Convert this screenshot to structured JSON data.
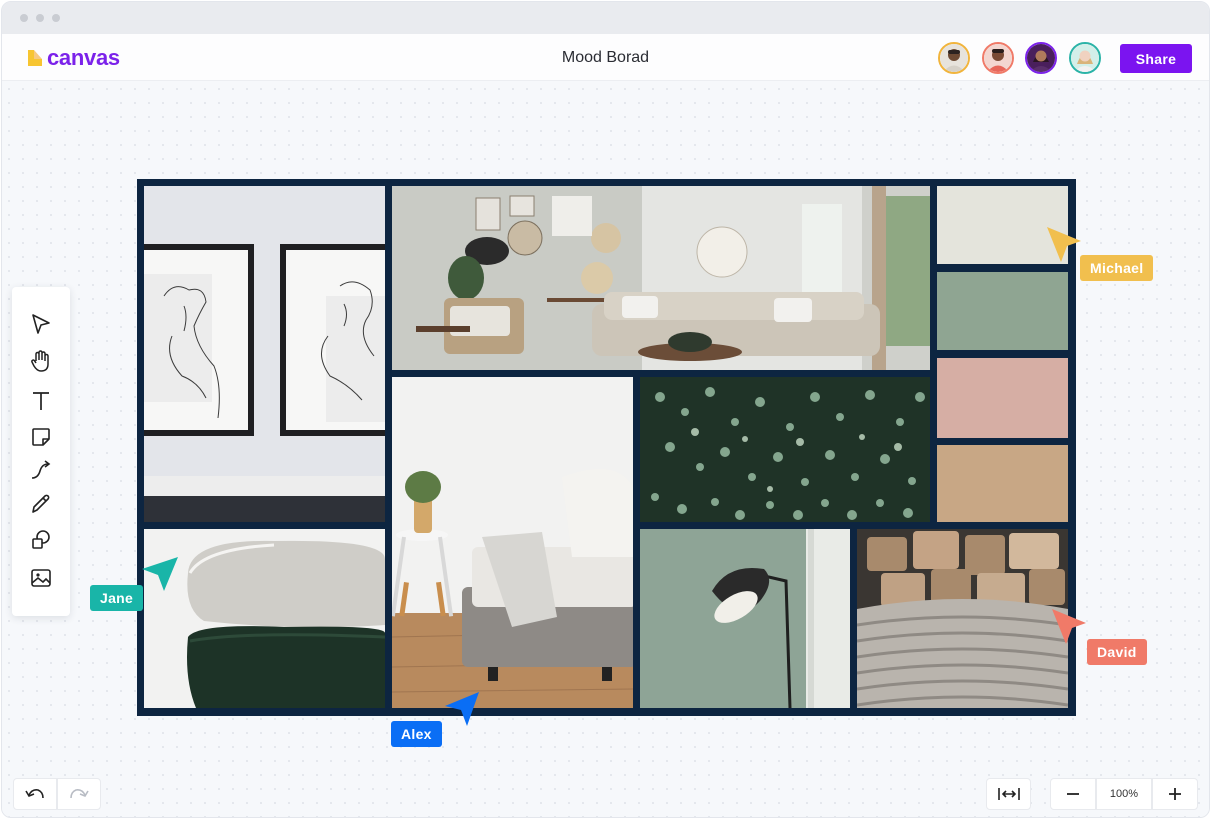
{
  "app": {
    "brand": "canvas",
    "title": "Mood Borad",
    "brand_color": "#7b22ea",
    "share_label": "Share"
  },
  "collaborators": [
    {
      "name": "avatar-1",
      "ring": "#f1b43c"
    },
    {
      "name": "avatar-2",
      "ring": "#f07a68"
    },
    {
      "name": "avatar-3",
      "ring": "#7b22ea"
    },
    {
      "name": "avatar-4",
      "ring": "#2bb3a7"
    }
  ],
  "tools": [
    {
      "name": "select-tool",
      "icon": "pointer-arrow-icon"
    },
    {
      "name": "hand-tool",
      "icon": "hand-icon"
    },
    {
      "name": "text-tool",
      "icon": "text-icon"
    },
    {
      "name": "sticky-note-tool",
      "icon": "sticky-note-icon"
    },
    {
      "name": "connector-tool",
      "icon": "connector-icon"
    },
    {
      "name": "pen-tool",
      "icon": "pencil-icon"
    },
    {
      "name": "shapes-tool",
      "icon": "shapes-icon"
    },
    {
      "name": "image-tool",
      "icon": "image-icon"
    }
  ],
  "palette": [
    "#e4e4dc",
    "#8fa592",
    "#d6aea4",
    "#c8a785"
  ],
  "cursors": {
    "michael": {
      "label": "Michael",
      "color": "#f1bf4e"
    },
    "jane": {
      "label": "Jane",
      "color": "#19b5a8"
    },
    "david": {
      "label": "David",
      "color": "#f07a68"
    },
    "alex": {
      "label": "Alex",
      "color": "#0a6ef5"
    }
  },
  "zoom": {
    "value": "100%"
  }
}
